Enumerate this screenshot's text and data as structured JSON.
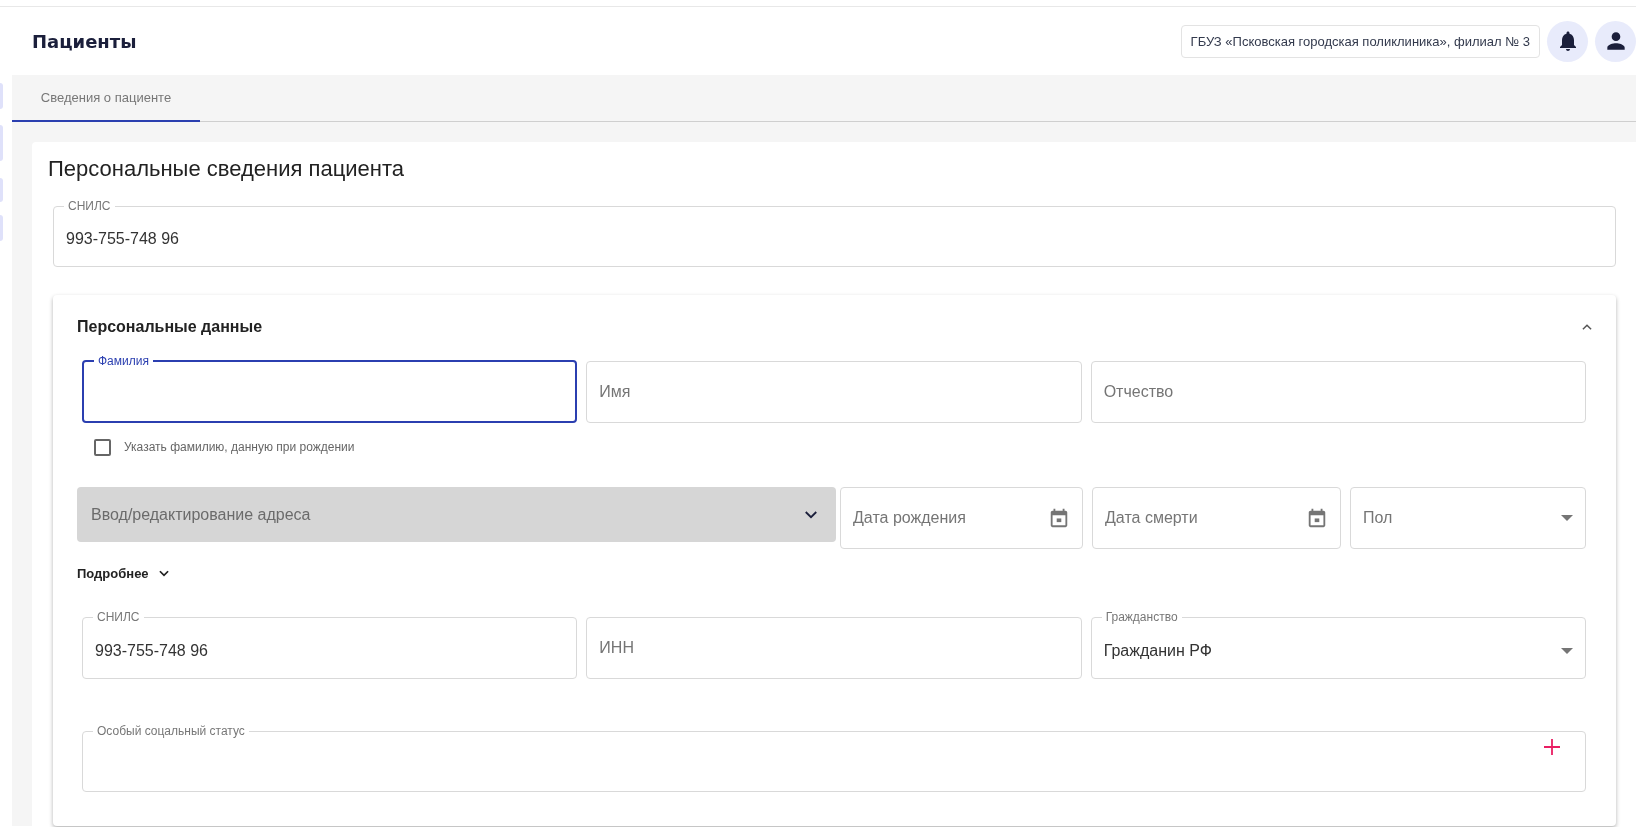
{
  "header": {
    "title": "Пациенты",
    "organization": "ГБУЗ «Псковская городская поликлиника», филиал № 3"
  },
  "tabs": [
    {
      "label": "Сведения о пациенте",
      "selected": true
    }
  ],
  "section": {
    "title": "Персональные сведения пациента",
    "snils": {
      "label": "СНИЛС",
      "value": "993-755-748 96"
    }
  },
  "personal": {
    "title": "Персональные данные",
    "expanded": true,
    "name_fields": [
      {
        "label": "Фамилия",
        "focused": true
      },
      {
        "placeholder": "Имя",
        "focused": false
      },
      {
        "placeholder": "Отчество",
        "focused": false
      }
    ],
    "birth_surname": {
      "label": "Указать фамилию, данную при рождении",
      "checked": false
    },
    "address": {
      "placeholder": "Ввод/редактирование адреса"
    },
    "date_sex_fields": [
      {
        "kind": "date",
        "placeholder": "Дата рождения"
      },
      {
        "kind": "date",
        "placeholder": "Дата смерти"
      },
      {
        "kind": "select",
        "placeholder": "Пол"
      }
    ],
    "more": {
      "label": "Подробнее",
      "expanded": false
    },
    "identity_fields": [
      {
        "kind": "text",
        "label": "СНИЛС",
        "value": "993-755-748 96"
      },
      {
        "kind": "text",
        "placeholder": "ИНН"
      },
      {
        "kind": "select",
        "label": "Гражданство",
        "value": "Гражданин РФ"
      }
    ],
    "social_status": {
      "label": "Особый соцальный статус"
    }
  }
}
